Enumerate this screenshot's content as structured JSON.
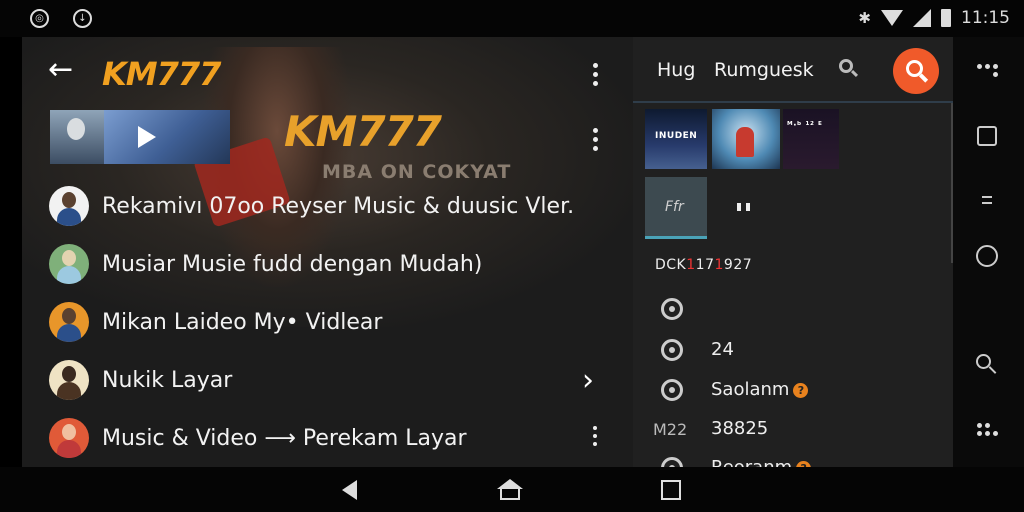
{
  "status_bar": {
    "time": "11:15",
    "left_icons": [
      "app-notification-icon",
      "download-notification-icon"
    ],
    "right_icons": [
      "vibrate-icon",
      "wifi-icon",
      "signal-icon",
      "battery-icon"
    ]
  },
  "left_pane": {
    "brand": "KM777",
    "backdrop_logo": "KM777",
    "backdrop_sub": "MBA ON COKYAT",
    "list": [
      {
        "label": "Rekamivı 07oo  Reyser Music & duusic Vler.",
        "avatar_color": "#f2f2f2",
        "badge": true
      },
      {
        "label": "Musiar Musie fudd dengan Mudah)",
        "avatar_color": "#7fb07a",
        "badge": false
      },
      {
        "label": "Mikan Laideo My• Vidlear",
        "avatar_color": "#e8962a",
        "badge": false
      },
      {
        "label": "Nukik Layar",
        "avatar_color": "#efe3c4",
        "badge": false
      },
      {
        "label": "Music & Video ⟶ Perekam Layar",
        "avatar_color": "#e05a38",
        "badge": true
      },
      {
        "label": "",
        "avatar_color": "#3cb043",
        "badge": false
      }
    ]
  },
  "right_pane": {
    "tab1": "Hug",
    "tab2": "Rumguesk",
    "thumb1_caption": "INUDEN",
    "thumb3_caption": "ᴹ·ᵇ ¹² ᴱ",
    "thumb4_text": "Ffr",
    "code_prefix": "DCK",
    "code_red": "1",
    "code_mid": "17",
    "code_red2": "1",
    "code_suffix": "927",
    "rows": [
      {
        "text": "",
        "prefix": ""
      },
      {
        "text": "24",
        "prefix": ""
      },
      {
        "text": "Saolanm",
        "prefix": ""
      },
      {
        "text": "38825",
        "prefix": "M22"
      },
      {
        "text": "Reoranm",
        "prefix": ""
      }
    ],
    "accent": "#f05a2a"
  },
  "navbar": {
    "buttons": [
      "back-icon",
      "home-icon",
      "recents-icon"
    ]
  }
}
